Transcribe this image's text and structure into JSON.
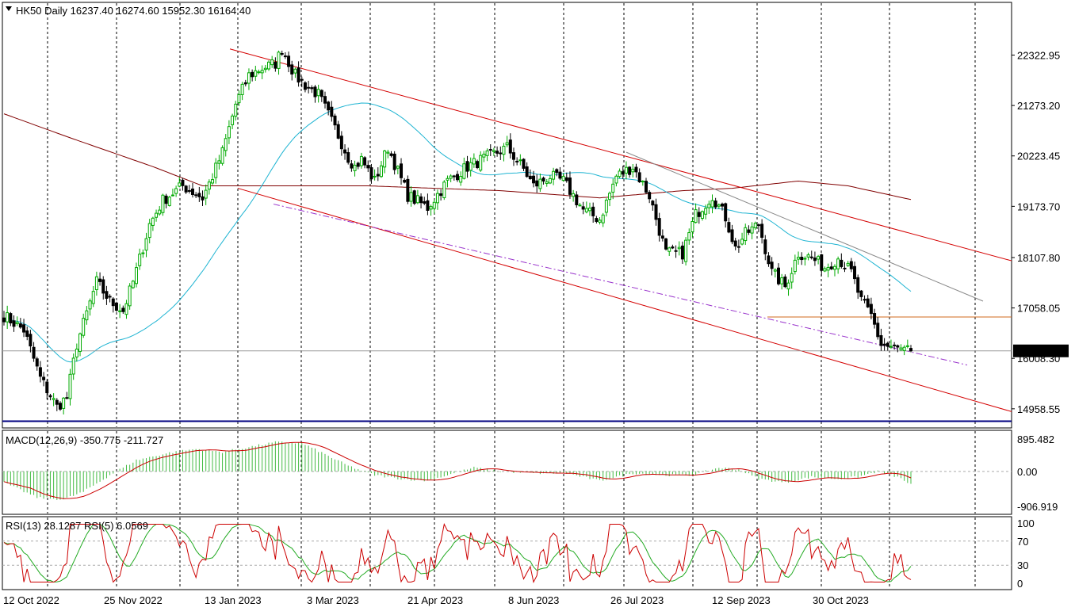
{
  "chart_data": {
    "type": "candlestick",
    "main": {
      "title": "HK50 Daily  16237.40 16274.60 15952.30 16164.40",
      "last_price_label": "16164.40",
      "y_ticks": [
        "22322.95",
        "21273.20",
        "20223.45",
        "19173.70",
        "18107.80",
        "17058.05",
        "16008.30",
        "14958.55"
      ],
      "y_tick_values": [
        22322.95,
        21273.2,
        20223.45,
        19173.7,
        18107.8,
        17058.05,
        16008.3,
        14958.55
      ],
      "ylim": [
        14560,
        23420
      ],
      "last_price": 16164.4,
      "support_level": 14700,
      "horizontal_level": 16870
    },
    "x_labels": [
      "12 Oct 2022",
      "25 Nov 2022",
      "13 Jan 2023",
      "3 Mar 2023",
      "21 Apr 2023",
      "8 Jun 2023",
      "26 Jul 2023",
      "12 Sep 2023",
      "30 Oct 2023"
    ],
    "bar_count": 275,
    "macd": {
      "title": "MACD(12,26,9) -350.775 -211.727",
      "y_ticks": [
        "895.482",
        "0.00",
        "-906.919"
      ],
      "ylim": [
        -1150,
        1100
      ]
    },
    "rsi": {
      "title": "RSI(13) 28.1287  RSI(5) 6.0569",
      "y_ticks": [
        "100",
        "70",
        "30",
        "0"
      ],
      "levels": [
        70,
        30
      ]
    },
    "colors": {
      "bull": "#00aa00",
      "bear": "#000000",
      "ma_slow": "#800000",
      "ma_fast": "#1eb4d2",
      "channel": "#d40000",
      "trend": "#888888",
      "dashdot": "#9933cc",
      "horizontal": "#d2691e",
      "support": "#000080",
      "macd_hist": "#44bb44",
      "signal": "#cc0000",
      "rsi_fast": "#cc0000",
      "rsi_slow": "#22aa22"
    }
  }
}
